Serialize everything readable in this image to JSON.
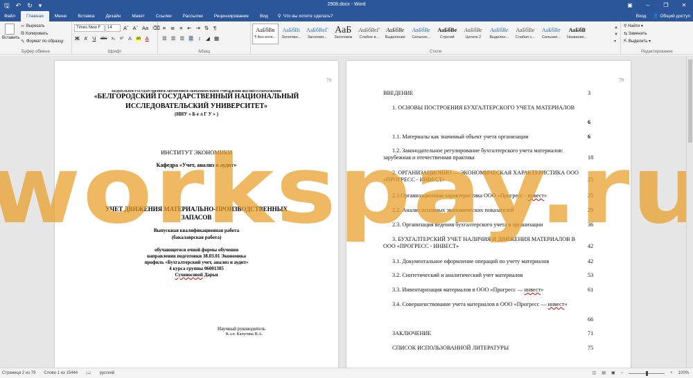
{
  "titlebar": {
    "title": "2908.docx - Word",
    "save_icon": "save-icon",
    "undo_icon": "undo-icon",
    "redo_icon": "redo-icon"
  },
  "tabs": {
    "items": [
      "Файл",
      "Главная",
      "Меню",
      "Вставка",
      "Дизайн",
      "Макет",
      "Ссылки",
      "Рассылки",
      "Рецензирование",
      "Вид"
    ],
    "active": "Главная",
    "tell_me": "Что вы хотите сделать?",
    "login": "Вход",
    "share": "Общий доступ"
  },
  "ribbon": {
    "clipboard": {
      "paste": "Вставить",
      "cut": "Вырезать",
      "copy": "Копировать",
      "format_painter": "Формат по образцу",
      "label": "Буфер обмена"
    },
    "font": {
      "name": "Times New F",
      "size": "14",
      "label": "Шрифт",
      "buttons": [
        "Ж",
        "К",
        "Ч",
        "abc",
        "x₂",
        "x²",
        "A",
        "ab",
        "A"
      ]
    },
    "paragraph": {
      "label": "Абзац"
    },
    "styles": {
      "label": "Стили",
      "items": [
        {
          "sample": "АаБбВв",
          "name": "¶ Без инте..."
        },
        {
          "sample": "АаБбВі",
          "name": "Заголово..."
        },
        {
          "sample": "АаБбВеГ",
          "name": "Заголово..."
        },
        {
          "sample": "АаБ",
          "name": "Заголовок"
        },
        {
          "sample": "АаБбВеГ",
          "name": "Слабое в..."
        },
        {
          "sample": "АаБбВе",
          "name": "Выделение"
        },
        {
          "sample": "АаБбВе",
          "name": "Сильное..."
        },
        {
          "sample": "АаБбВе",
          "name": "Строгий"
        },
        {
          "sample": "АаБбВе",
          "name": "Цитата 2"
        },
        {
          "sample": "АаБбВе",
          "name": "Выделен..."
        },
        {
          "sample": "АаБбВе",
          "name": "Слабая с..."
        },
        {
          "sample": "АаБбВе",
          "name": "Сильная..."
        },
        {
          "sample": "АаБбВ",
          "name": "Название..."
        }
      ]
    },
    "editing": {
      "find": "Найти",
      "replace": "Заменить",
      "select": "Выделить",
      "label": "Редактирование"
    }
  },
  "page1": {
    "number": "79",
    "l1": "ФЕДЕРАЛЬНОЕ ГОСУДАРСТВЕННОЕ АВТОНОМНОЕ ОБРАЗОВАТЕЛЬНОЕ УЧРЕЖДЕНИЕ ВЫСШЕГО ОБРАЗОВАНИЯ",
    "l2": "«БЕЛГОРОДСКИЙ ГОСУДАРСТВЕННЫЙ НАЦИОНАЛЬНЫЙ",
    "l3": "ИССЛЕДОВАТЕЛЬСКИЙ УНИВЕРСИТЕТ»",
    "l4": "(НИУ « Б е л Г У » )",
    "institute": "ИНСТИТУТ ЭКОНОМИКИ",
    "department": "Кафедра «Учет, анализ и аудит»",
    "topic1": "УЧЕТ ДВИЖЕНИЯ МАТЕРИАЛЬНО-ПРОИЗВОДСТВЕННЫХ",
    "topic2": "ЗАПАСОВ",
    "work1": "Выпускная квалификационная работа",
    "work2": "(бакалаврская работа)",
    "s1": "обучающегося очной формы обучения",
    "s2": "направления подготовки 38.03.01 Экономика",
    "s3": "профиль «Бухгалтерский учет, анализ и аудит»",
    "s4": "4 курса группы 06001305",
    "s5": "Сухоносовой Дарьи",
    "supervisor": "Научный руководитель",
    "supervisor_name": "К.э.н. Калугина Н.А."
  },
  "page2": {
    "number": "79",
    "toc": [
      {
        "text": "ВВЕДЕНИЕ",
        "page": "3"
      },
      {
        "text": "1.  ОСНОВЫ ПОСТРОЕНИЯ БУХГАЛТЕРСКОГО УЧЕТА МАТЕРИАЛОВ",
        "page": "6"
      },
      {
        "text": "1.1. Материалы как значимый объект учета организации",
        "page": "6"
      },
      {
        "text": "1.2. Законодательное регулирование бухгалтерского учета материалов:",
        "text2": "зарубежная и отечественная практика",
        "page": "18"
      },
      {
        "text": "2. ОРГАНИЗАЦИОННО — ЭКОНОМИЧЕСКАЯ ХАРАКТЕРИСТИКА ООО",
        "text2": "«ПРОГРЕСС - ИНВЕСТ»",
        "page": "25"
      },
      {
        "text": "2.1.Организационная характеристика ООО «Прогресс - инвест»",
        "page": "25"
      },
      {
        "text": "2.2. Анализ основных экономических показателей",
        "page": "29"
      },
      {
        "text": "2.3. Организация ведения бухгалтерского учета в организации",
        "page": "36"
      },
      {
        "text": "3. БУХГАЛТЕРСКИЙ УЧЕТ НАЛИЧИЯ И ДВИЖЕНИЯ МАТЕРИАЛОВ В",
        "text2": "ООО «ПРОГРЕСС - ИНВЕСТ»",
        "page": "42"
      },
      {
        "text": "3.1. Документальное оформление операций по учету материалов",
        "page": "42"
      },
      {
        "text": "3.2. Синтетический и аналитический учет материалов",
        "page": "53"
      },
      {
        "text": "3.3. Инвентаризация материалов в ООО «Прогресс — инвест»",
        "page": "61"
      },
      {
        "text": "3.4. Совершенствование учета материалов в ООО «Прогресс — инвест»",
        "page": ""
      },
      {
        "text": "",
        "page": "66"
      },
      {
        "text": "ЗАКЛЮЧЕНИЕ",
        "page": "71"
      },
      {
        "text": "СПИСОК ИСПОЛЬЗОВАННОЙ ЛИТЕРАТУРЫ",
        "page": "75"
      }
    ]
  },
  "watermark": "workspay.ru",
  "statusbar": {
    "page": "Страница 2 из 79",
    "words": "Слово 1 из 15444",
    "language": "русский",
    "zoom": "100%",
    "zoom_minus": "−",
    "zoom_plus": "+"
  },
  "colors": {
    "accent": "#2b579a",
    "watermark": "#e89e26"
  }
}
